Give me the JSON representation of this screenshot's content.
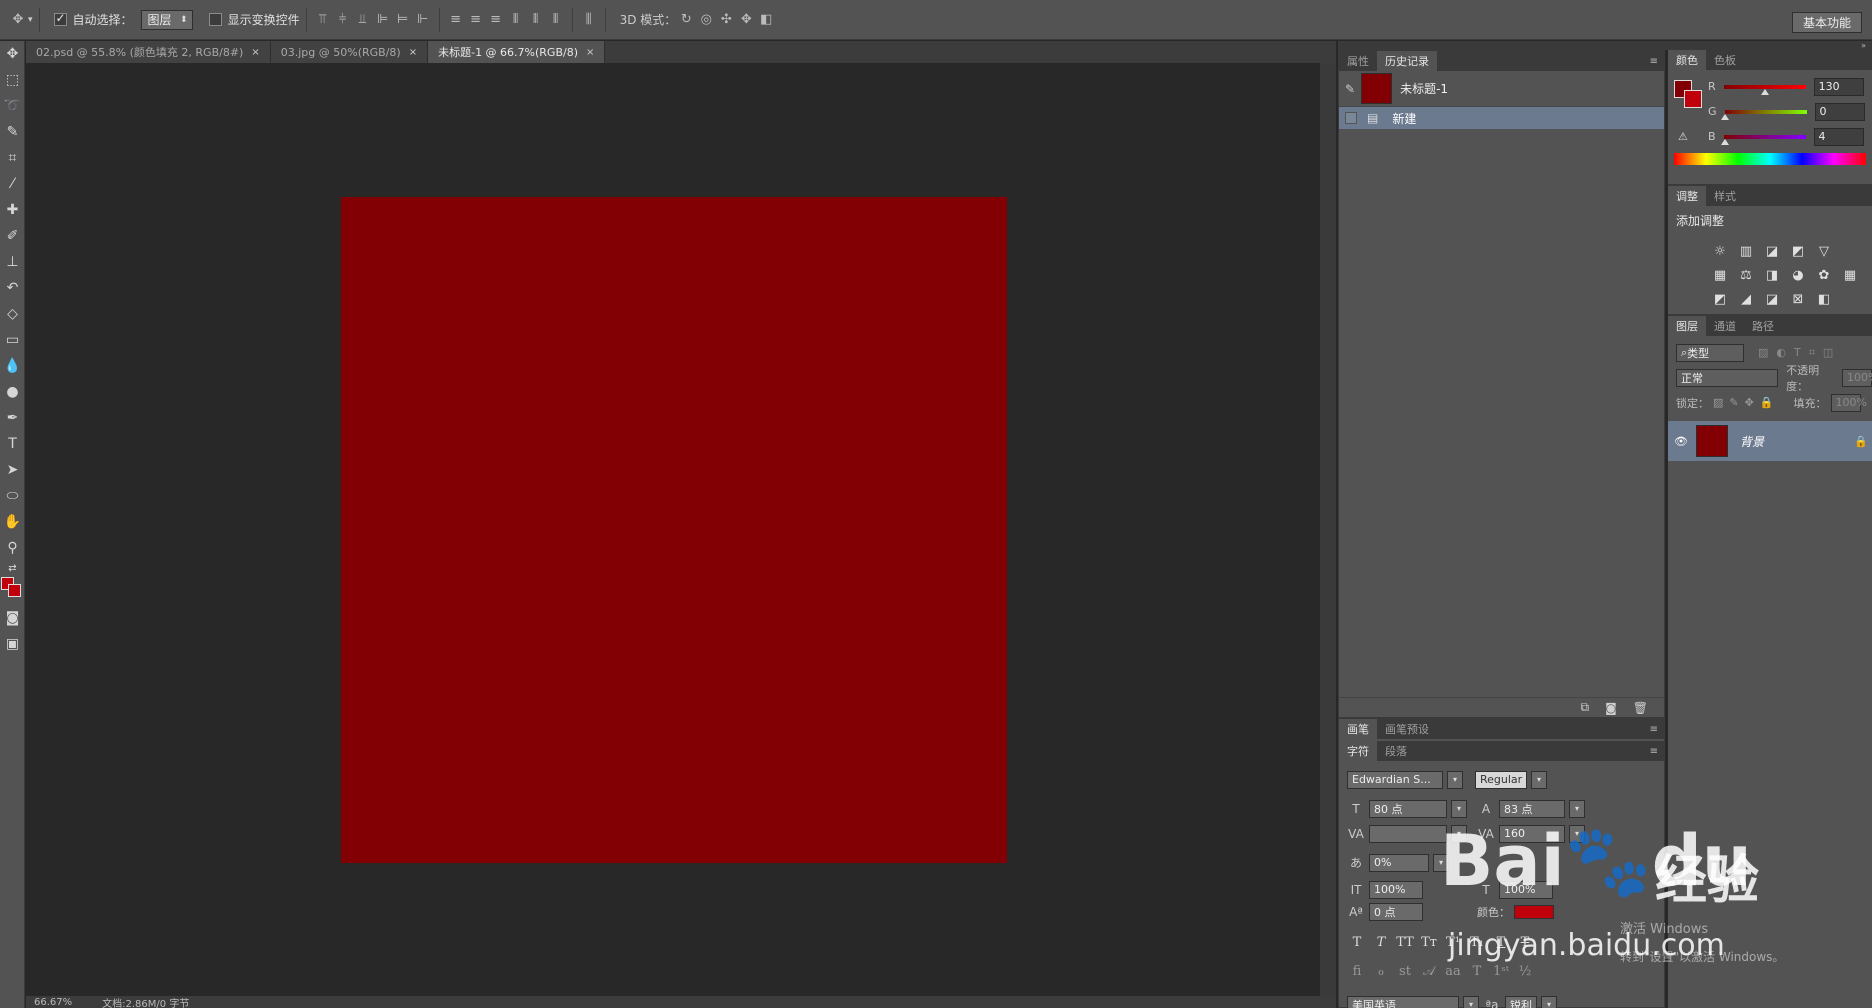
{
  "options_bar": {
    "auto_select_label": "自动选择：",
    "auto_select_value": "图层",
    "show_transform_label": "显示变换控件",
    "mode_3d_label": "3D 模式：",
    "workspace_label": "基本功能"
  },
  "tabs": [
    {
      "label": "02.psd @ 55.8% (颜色填充 2, RGB/8#)"
    },
    {
      "label": "03.jpg @ 50%(RGB/8)"
    },
    {
      "label": "未标题-1 @ 66.7%(RGB/8)"
    }
  ],
  "status": {
    "zoom": "66.67%",
    "doc": "文档:2.86M/0 字节"
  },
  "canvas": {
    "fill_color": "#820004"
  },
  "history_panel": {
    "tab_properties": "属性",
    "tab_history": "历史记录",
    "snapshot_label": "未标题-1",
    "state_label": "新建"
  },
  "brush_panel": {
    "tab_brush": "画笔",
    "tab_brush_presets": "画笔预设"
  },
  "character_panel": {
    "tab_character": "字符",
    "tab_paragraph": "段落",
    "font_family": "Edwardian S...",
    "font_style": "Regular",
    "font_size": "80 点",
    "leading": "83 点",
    "kerning": "",
    "tracking": "160",
    "scale_percent": "0%",
    "vertical_scale": "100%",
    "horizontal_scale": "100%",
    "baseline_shift": "0 点",
    "color_label": "颜色：",
    "language": "美国英语",
    "aa_label": "aa",
    "antialias": "锐利"
  },
  "color_panel": {
    "tab_color": "颜色",
    "tab_swatches": "色板",
    "r_label": "R",
    "g_label": "G",
    "b_label": "B",
    "r_value": "130",
    "g_value": "0",
    "b_value": "4",
    "foreground": "#820004"
  },
  "adjustments_panel": {
    "tab_adjustments": "调整",
    "tab_styles": "样式",
    "add_label": "添加调整"
  },
  "layers_panel": {
    "tab_layers": "图层",
    "tab_channels": "通道",
    "tab_paths": "路径",
    "filter_label": "类型",
    "blend_mode": "正常",
    "opacity_label": "不透明度：",
    "opacity_value": "100%",
    "lock_label": "锁定：",
    "fill_label": "填充：",
    "fill_value": "100%",
    "layer_name": "背景"
  },
  "watermark": {
    "brand": "Bai",
    "brand2": "du",
    "site_cn": "经验",
    "url": "jingyan.baidu.com",
    "activate_line1": "激活 Windows",
    "activate_line2": "转到\"设置\"以激活 Windows。"
  }
}
